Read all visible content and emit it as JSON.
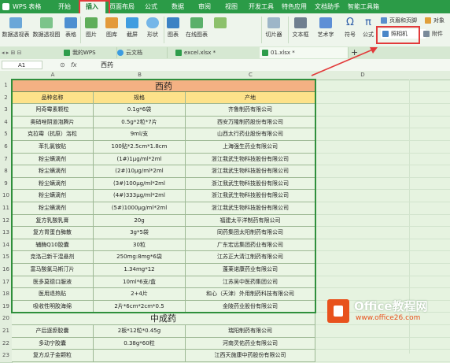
{
  "menubar": {
    "app": "WPS 表格",
    "items": [
      "开始",
      "插入",
      "页面布局",
      "公式",
      "数据",
      "审阅",
      "视图",
      "开发工具",
      "特色应用",
      "文档助手",
      "智能工具箱"
    ]
  },
  "ribbon": {
    "buttons": [
      "数据透视表",
      "数据透视图",
      "表格",
      "图片",
      "图库",
      "截屏",
      "形状",
      "图表",
      "在线图表",
      "切片器",
      "文本框",
      "艺术字",
      "符号",
      "公式"
    ],
    "small": {
      "header_footer": "页眉和页脚",
      "object": "对象",
      "camera": "照相机",
      "attachment": "附件"
    }
  },
  "tabs": {
    "my_wps": "我的WPS",
    "cloud": "云文档",
    "excel_file": "excel.xlsx *",
    "active_file": "01.xlsx *",
    "add": "+"
  },
  "formula": {
    "cell_ref": "A1",
    "fx": "fx",
    "value": "西药"
  },
  "columns": [
    "A",
    "B",
    "C",
    "D"
  ],
  "sheet": {
    "title_xiyao": "西药",
    "headers": [
      "品种名称",
      "规格",
      "产地"
    ],
    "rows": [
      [
        "阿奇霉素颗粒",
        "0.1g*6袋",
        "齐鲁制药有限公司"
      ],
      [
        "奥硝唑阴道泡腾片",
        "0.5g*2粒*7片",
        "西安万隆制药股份有限公司"
      ],
      [
        "克拉霉（抗原）洛粒",
        "9ml/支",
        "山西太行药业股份有限公司"
      ],
      [
        "苯扎氯铵贴",
        "100贴*2.5cm*1.8cm",
        "上海强生药业有限公司"
      ],
      [
        "粉尘螨滴剂",
        "(1#)1μg/ml*2ml",
        "浙江我武生物科技股份有限公司"
      ],
      [
        "粉尘螨滴剂",
        "(2#)10μg/ml*2ml",
        "浙江我武生物科技股份有限公司"
      ],
      [
        "粉尘螨滴剂",
        "(3#)100μg/ml*2ml",
        "浙江我武生物科技股份有限公司"
      ],
      [
        "粉尘螨滴剂",
        "(4#)333μg/ml*2ml",
        "浙江我武生物科技股份有限公司"
      ],
      [
        "粉尘螨滴剂",
        "(5#)1000μg/ml*2ml",
        "浙江我武生物科技股份有限公司"
      ],
      [
        "复方乳酸乳膏",
        "20g",
        "福建太平洋制药有限公司"
      ],
      [
        "复方胃蛋白酶散",
        "3g*5袋",
        "同药集团太阳制药有限公司"
      ],
      [
        "辅酶Q10胶囊",
        "30粒",
        "广东宏远集团药业有限公司"
      ],
      [
        "克洛己新干混悬剂",
        "250mg:8mg*6袋",
        "江苏正大清江制药有限公司"
      ],
      [
        "富马酸氯马斯汀片",
        "1.34mg*12",
        "蓬莱诺康药业有限公司"
      ],
      [
        "医多莫德口服液",
        "10ml*6支/盒",
        "江苏吴中医药集团公司"
      ],
      [
        "医用退热贴",
        "2+4片",
        "和心（天津）外用制药科技有限公司"
      ],
      [
        "吸收性明胶海绵",
        "2片*6cm*2cm*0.5",
        "金陵药业股份有限公司"
      ]
    ],
    "title_zhongchengyao": "中成药",
    "rows2": [
      [
        "产后逐瘀胶囊",
        "2板*12粒*0.45g",
        "瑞阳制药有限公司"
      ],
      [
        "多动宁胶囊",
        "0.38g*60粒",
        "河南灵佑药业有限公司"
      ],
      [
        "复方瓜子金颗粒",
        "",
        "江西天施康中药股份有限公司"
      ]
    ],
    "row_numbers": [
      "1",
      "2",
      "3",
      "4",
      "5",
      "6",
      "7",
      "8",
      "9",
      "10",
      "11",
      "12",
      "13",
      "14",
      "15",
      "16",
      "17",
      "18",
      "19",
      "20",
      "21",
      "22",
      "23"
    ]
  },
  "watermark": {
    "brand": "Office教程网",
    "url": "www.office26.com"
  }
}
